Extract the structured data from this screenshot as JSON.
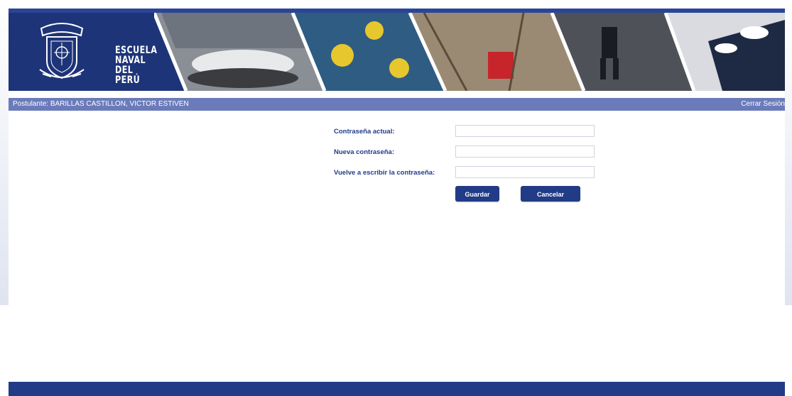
{
  "brand": {
    "logo_lines": [
      "ESCUELA",
      "NAVAL",
      "DEL PERÚ"
    ],
    "primary_color": "#1d3478",
    "bar_color": "#6b7bba",
    "button_color": "#223b86",
    "label_color": "#1f3c88"
  },
  "userbar": {
    "postulante": "Postulante: BARILLAS CASTILLON, VICTOR ESTIVEN",
    "logout": "Cerrar Sesión"
  },
  "form": {
    "current_password_label": "Contraseña actual:",
    "current_password_value": "",
    "new_password_label": "Nueva contraseña:",
    "new_password_value": "",
    "confirm_password_label": "Vuelve a escribir la contraseña:",
    "confirm_password_value": "",
    "save_label": "Guardar",
    "cancel_label": "Cancelar"
  }
}
